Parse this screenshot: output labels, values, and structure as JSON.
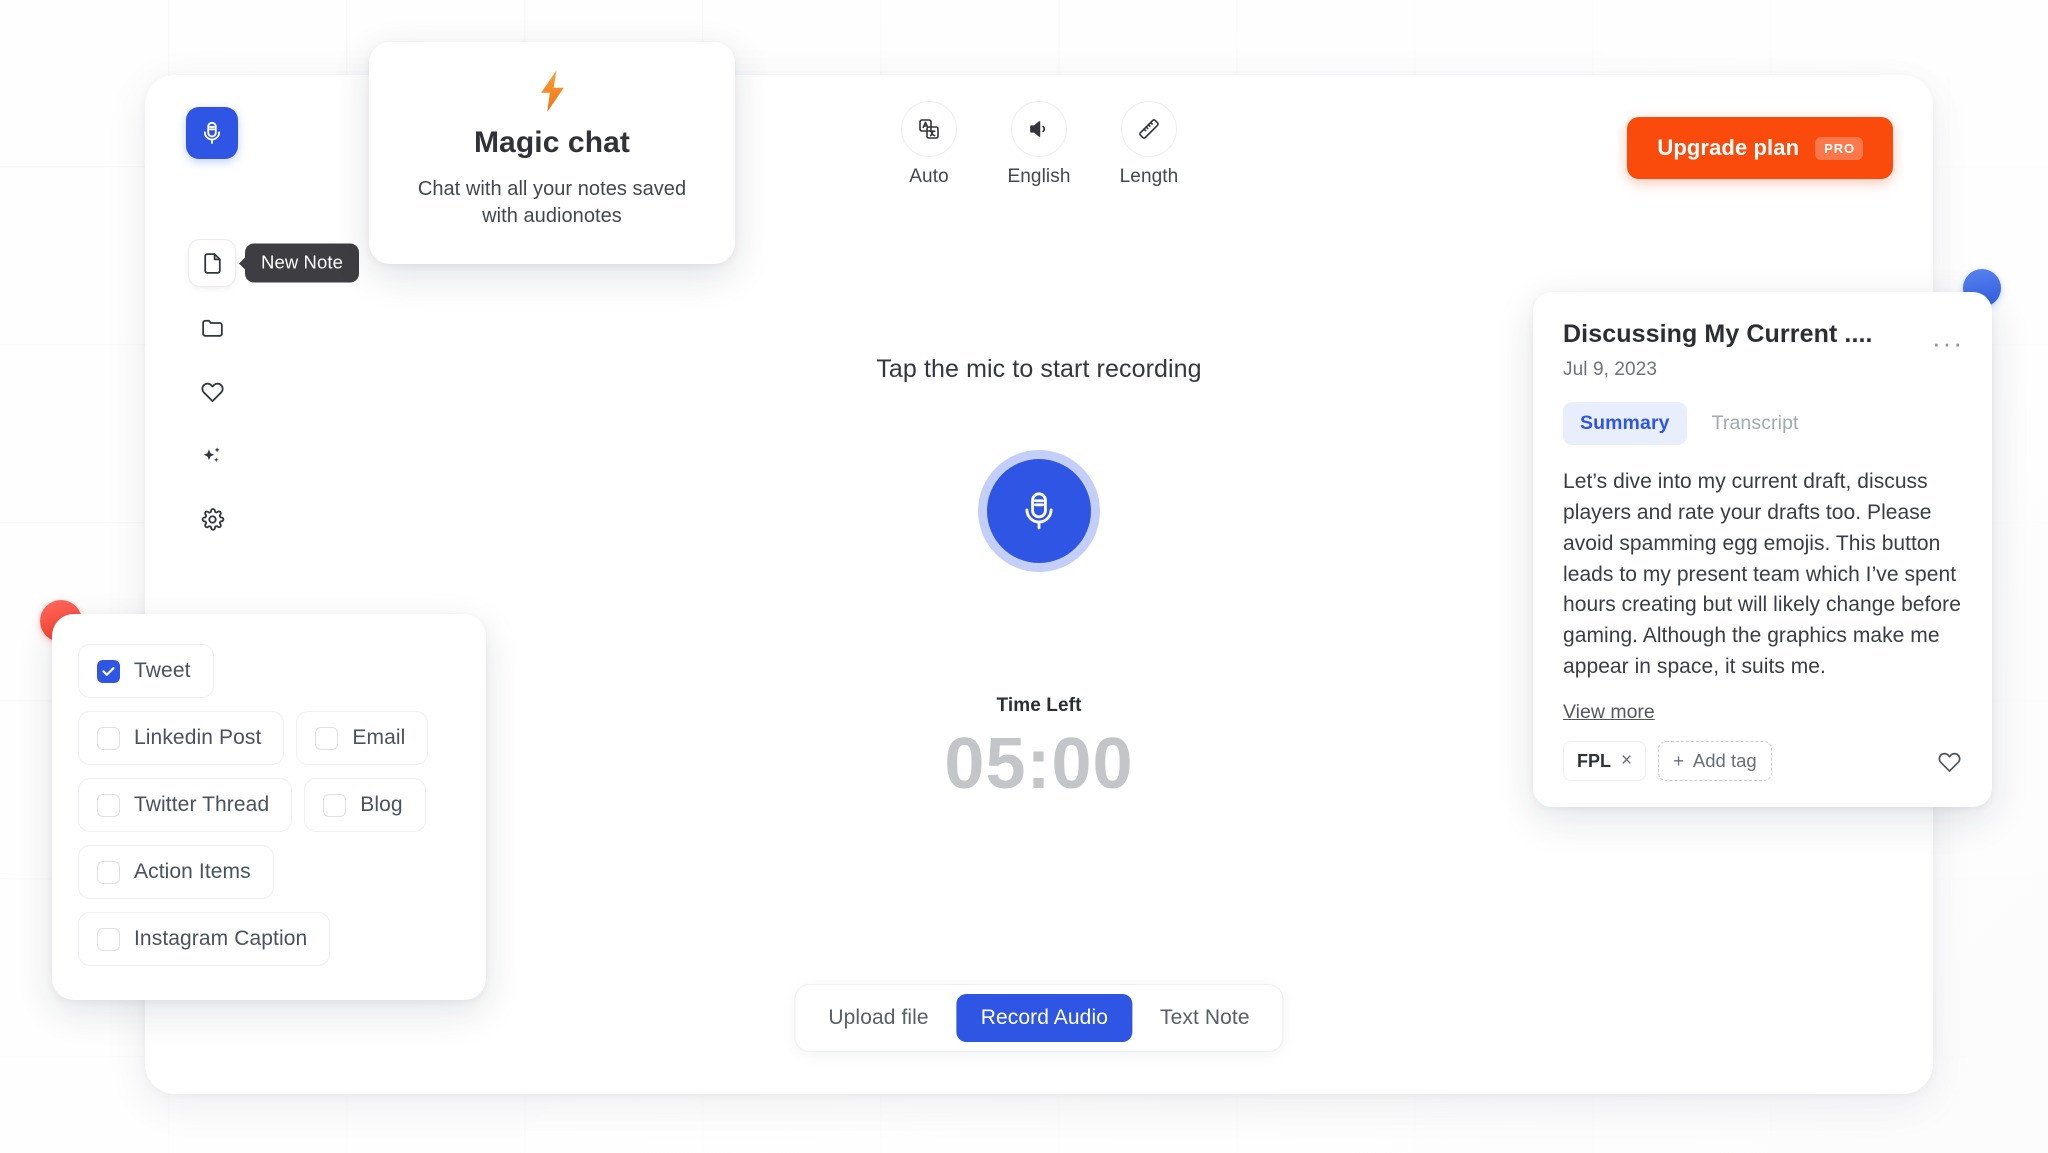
{
  "app": {
    "brand_color": "#2f55e4",
    "accent_color": "#fa4a0c",
    "logo_icon": "microphone-icon"
  },
  "sidebar": {
    "items": [
      {
        "id": "new-note",
        "label": "New Note",
        "icon": "document-icon",
        "active": true,
        "tooltip": "New Note"
      },
      {
        "id": "folders",
        "label": "Folders",
        "icon": "folder-icon",
        "active": false
      },
      {
        "id": "favorites",
        "label": "Favorites",
        "icon": "heart-icon",
        "active": false
      },
      {
        "id": "magic",
        "label": "Magic",
        "icon": "sparkles-icon",
        "active": false
      },
      {
        "id": "settings",
        "label": "Settings",
        "icon": "gear-icon",
        "active": false
      }
    ]
  },
  "topbar": {
    "tools": [
      {
        "label": "Auto",
        "icon": "translate-icon"
      },
      {
        "label": "English",
        "icon": "speaker-icon"
      },
      {
        "label": "Length",
        "icon": "ruler-icon"
      }
    ],
    "upgrade": {
      "label": "Upgrade plan",
      "badge": "PRO"
    }
  },
  "recorder": {
    "hint": "Tap the mic to start recording",
    "mic_icon": "microphone-icon",
    "timer_label": "Time Left",
    "timer_value": "05:00"
  },
  "modes": {
    "options": [
      {
        "label": "Upload file",
        "active": false
      },
      {
        "label": "Record Audio",
        "active": true
      },
      {
        "label": "Text Note",
        "active": false
      }
    ]
  },
  "magic_chat": {
    "icon": "lightning-bolt-icon",
    "bolt": "⚡",
    "title": "Magic chat",
    "subtitle": "Chat with all your notes saved with audionotes"
  },
  "format_panel": {
    "rows": [
      [
        {
          "label": "Tweet",
          "checked": true
        }
      ],
      [
        {
          "label": "Linkedin Post",
          "checked": false
        },
        {
          "label": "Email",
          "checked": false
        }
      ],
      [
        {
          "label": "Twitter Thread",
          "checked": false
        },
        {
          "label": "Blog",
          "checked": false
        }
      ],
      [
        {
          "label": "Action Items",
          "checked": false
        }
      ],
      [
        {
          "label": "Instagram Caption",
          "checked": false
        }
      ]
    ]
  },
  "note": {
    "title": "Discussing My Current ....",
    "date": "Jul 9, 2023",
    "kebab": "···",
    "tabs": [
      {
        "label": "Summary",
        "active": true
      },
      {
        "label": "Transcript",
        "active": false
      }
    ],
    "summary": "Let’s dive into my current draft, discuss players and rate your drafts too. Please avoid spamming egg emojis. This button leads to my present team which I’ve spent hours creating but will likely change before gaming. Although the graphics make me appear in space, it suits me.",
    "view_more": "View more",
    "tag": {
      "label": "FPL",
      "remove": "×"
    },
    "add_tag": "Add tag",
    "add_tag_plus": "+",
    "favorite_icon": "heart-icon"
  },
  "decorations": {
    "red_dot_color": "#f53a2b",
    "blue_dot_color": "#2f5fe0"
  }
}
